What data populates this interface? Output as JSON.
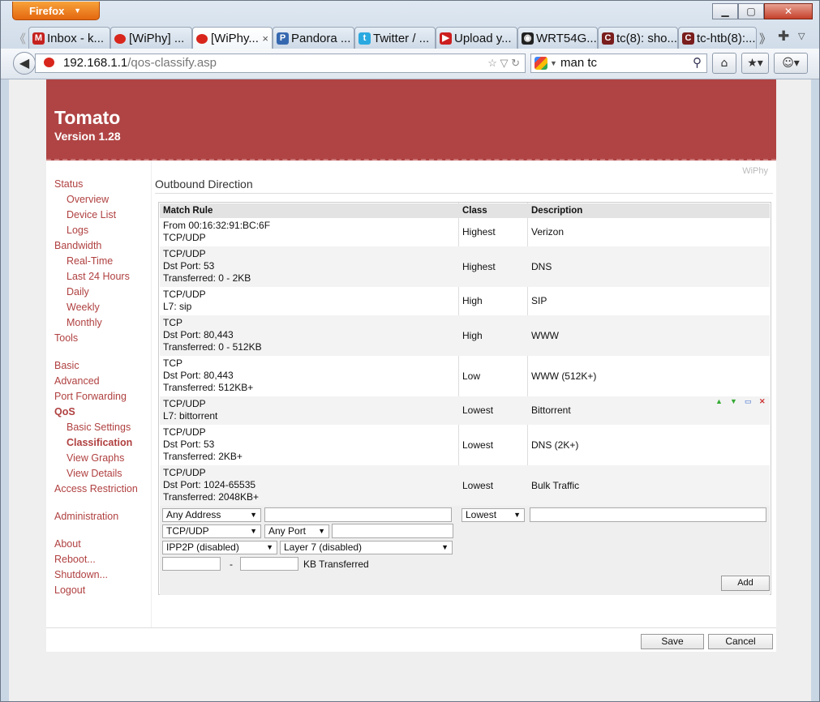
{
  "browser": {
    "menu_label": "Firefox",
    "tabs": [
      {
        "label": "Inbox - k...",
        "icon": "gmail-icon",
        "color": "#c5221f",
        "glyph": "M"
      },
      {
        "label": "[WiPhy] ...",
        "icon": "tomato-icon",
        "color": "#d8261c",
        "glyph": ""
      },
      {
        "label": "[WiPhy...",
        "icon": "tomato-icon",
        "color": "#d8261c",
        "glyph": "",
        "active": true,
        "close": "×"
      },
      {
        "label": "Pandora ...",
        "icon": "pandora-icon",
        "color": "#3668b0",
        "glyph": "P"
      },
      {
        "label": "Twitter / ...",
        "icon": "twitter-icon",
        "color": "#2aa9e0",
        "glyph": "t"
      },
      {
        "label": "Upload y...",
        "icon": "youtube-icon",
        "color": "#cc1f1f",
        "glyph": "▶"
      },
      {
        "label": "WRT54G...",
        "icon": "github-icon",
        "color": "#222222",
        "glyph": "◉"
      },
      {
        "label": "tc(8): sho...",
        "icon": "linux-die-icon",
        "color": "#7a1d1d",
        "glyph": "C"
      },
      {
        "label": "tc-htb(8):...",
        "icon": "linux-die-icon",
        "color": "#7a1d1d",
        "glyph": "C"
      }
    ],
    "url_host": "192.168.1.1",
    "url_path": "/qos-classify.asp",
    "search_value": "man tc"
  },
  "header": {
    "title": "Tomato",
    "version": "Version 1.28"
  },
  "router_name": "WiPhy",
  "nav": [
    {
      "label": "Status",
      "level": 0
    },
    {
      "label": "Overview",
      "level": 1
    },
    {
      "label": "Device List",
      "level": 1
    },
    {
      "label": "Logs",
      "level": 1
    },
    {
      "label": "Bandwidth",
      "level": 0
    },
    {
      "label": "Real-Time",
      "level": 1
    },
    {
      "label": "Last 24 Hours",
      "level": 1
    },
    {
      "label": "Daily",
      "level": 1
    },
    {
      "label": "Weekly",
      "level": 1
    },
    {
      "label": "Monthly",
      "level": 1
    },
    {
      "label": "Tools",
      "level": 0
    },
    {
      "label": "Basic",
      "level": 0,
      "gap": true
    },
    {
      "label": "Advanced",
      "level": 0
    },
    {
      "label": "Port Forwarding",
      "level": 0
    },
    {
      "label": "QoS",
      "level": 0,
      "bold": true
    },
    {
      "label": "Basic Settings",
      "level": 1
    },
    {
      "label": "Classification",
      "level": 1,
      "bold": true
    },
    {
      "label": "View Graphs",
      "level": 1
    },
    {
      "label": "View Details",
      "level": 1
    },
    {
      "label": "Access Restriction",
      "level": 0
    },
    {
      "label": "Administration",
      "level": 0,
      "gap": true
    },
    {
      "label": "About",
      "level": 0,
      "gap": true
    },
    {
      "label": "Reboot...",
      "level": 0
    },
    {
      "label": "Shutdown...",
      "level": 0
    },
    {
      "label": "Logout",
      "level": 0
    }
  ],
  "section_title": "Outbound Direction",
  "table": {
    "headers": [
      "Match Rule",
      "Class",
      "Description"
    ],
    "rows": [
      {
        "rule": [
          "From 00:16:32:91:BC:6F",
          "TCP/UDP"
        ],
        "class": "Highest",
        "desc": "Verizon"
      },
      {
        "rule": [
          "TCP/UDP",
          "Dst Port: 53",
          "Transferred: 0 - 2KB"
        ],
        "class": "Highest",
        "desc": "DNS"
      },
      {
        "rule": [
          "TCP/UDP",
          "L7: sip"
        ],
        "class": "High",
        "desc": "SIP"
      },
      {
        "rule": [
          "TCP",
          "Dst Port: 80,443",
          "Transferred: 0 - 512KB"
        ],
        "class": "High",
        "desc": "WWW"
      },
      {
        "rule": [
          "TCP",
          "Dst Port: 80,443",
          "Transferred: 512KB+"
        ],
        "class": "Low",
        "desc": "WWW (512K+)"
      },
      {
        "rule": [
          "TCP/UDP",
          "L7: bittorrent"
        ],
        "class": "Lowest",
        "desc": "Bittorrent"
      },
      {
        "rule": [
          "TCP/UDP",
          "Dst Port: 53",
          "Transferred: 2KB+"
        ],
        "class": "Lowest",
        "desc": "DNS (2K+)"
      },
      {
        "rule": [
          "TCP/UDP",
          "Dst Port: 1024-65535",
          "Transferred: 2048KB+"
        ],
        "class": "Lowest",
        "desc": "Bulk Traffic"
      }
    ]
  },
  "form": {
    "address_select": "Any Address",
    "address_value": "",
    "proto_select": "TCP/UDP",
    "port_select": "Any Port",
    "port_value": "",
    "ipp2p_select": "IPP2P (disabled)",
    "layer7_select": "Layer 7 (disabled)",
    "kb_from": "",
    "kb_dash": "-",
    "kb_to": "",
    "kb_label": "KB Transferred",
    "class_select": "Lowest",
    "desc_value": "",
    "add_label": "Add"
  },
  "buttons": {
    "save": "Save",
    "cancel": "Cancel"
  }
}
